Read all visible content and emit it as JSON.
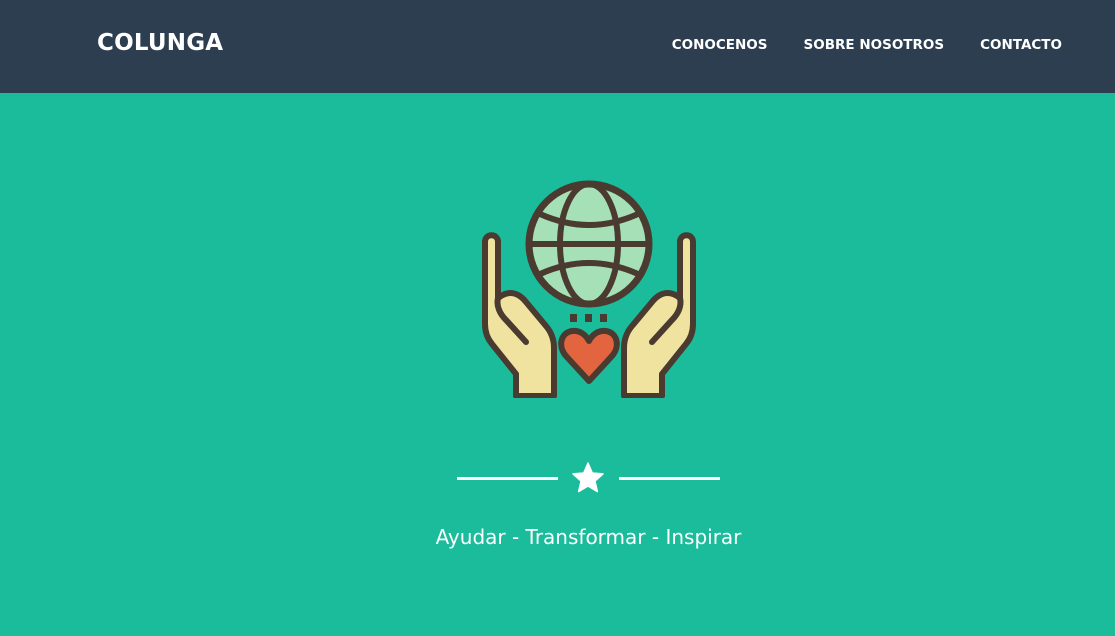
{
  "header": {
    "brand": "COLUNGA",
    "nav": [
      {
        "label": "CONOCENOS"
      },
      {
        "label": "SOBRE NOSOTROS"
      },
      {
        "label": "CONTACTO"
      }
    ]
  },
  "hero": {
    "icon": "hands-globe-heart-icon",
    "divider_icon": "star-icon",
    "tagline": "Ayudar - Transformar - Inspirar"
  },
  "colors": {
    "navbar": "#2c3e50",
    "background": "#1abc9c",
    "globe": "#a6e0b6",
    "hands": "#efe39f",
    "heart": "#e2653f",
    "outline": "#4a3a30"
  }
}
